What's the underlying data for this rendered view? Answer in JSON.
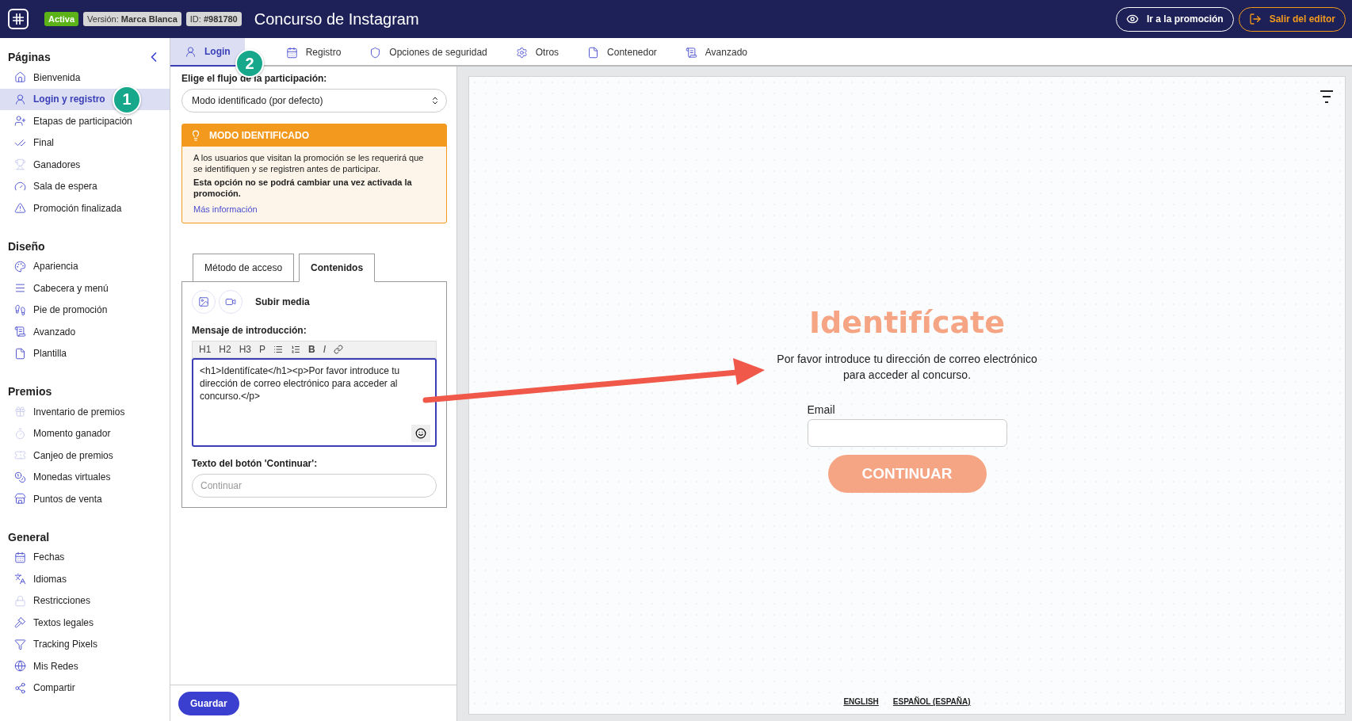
{
  "header": {
    "badges": [
      {
        "kind": "status",
        "value": "Activa"
      },
      {
        "kind": "tag",
        "label": "Versión:",
        "value": "Marca Blanca"
      },
      {
        "kind": "tag",
        "label": "ID:",
        "value": "#981780"
      }
    ],
    "title": "Concurso de Instagram",
    "actions": [
      {
        "kind": "outline",
        "label": "Ir a la promoción"
      },
      {
        "kind": "warning",
        "label": "Salir del editor"
      }
    ]
  },
  "sidebar": {
    "sections": [
      {
        "title": "Páginas",
        "items": [
          {
            "label": "Bienvenida",
            "selected": false,
            "disabled": false
          },
          {
            "label": "Login y registro",
            "selected": true,
            "disabled": false,
            "marker": "1"
          },
          {
            "label": "Etapas de participación",
            "selected": false,
            "disabled": false
          },
          {
            "label": "Final",
            "selected": false,
            "disabled": false
          },
          {
            "label": "Ganadores",
            "selected": false,
            "disabled": true
          },
          {
            "label": "Sala de espera",
            "selected": false,
            "disabled": false
          },
          {
            "label": "Promoción finalizada",
            "selected": false,
            "disabled": false
          }
        ]
      },
      {
        "title": "Diseño",
        "items": [
          {
            "label": "Apariencia",
            "selected": false,
            "disabled": false
          },
          {
            "label": "Cabecera y menú",
            "selected": false,
            "disabled": false
          },
          {
            "label": "Pie de promoción",
            "selected": false,
            "disabled": false
          },
          {
            "label": "Avanzado",
            "selected": false,
            "disabled": false
          },
          {
            "label": "Plantilla",
            "selected": false,
            "disabled": false
          }
        ]
      },
      {
        "title": "Premios",
        "items": [
          {
            "label": "Inventario de premios",
            "selected": false,
            "disabled": true
          },
          {
            "label": "Momento ganador",
            "selected": false,
            "disabled": true
          },
          {
            "label": "Canjeo de premios",
            "selected": false,
            "disabled": true
          },
          {
            "label": "Monedas virtuales",
            "selected": false,
            "disabled": false
          },
          {
            "label": "Puntos de venta",
            "selected": false,
            "disabled": false
          }
        ]
      },
      {
        "title": "General",
        "items": [
          {
            "label": "Fechas",
            "selected": false,
            "disabled": false
          },
          {
            "label": "Idiomas",
            "selected": false,
            "disabled": false
          },
          {
            "label": "Restricciones",
            "selected": false,
            "disabled": true
          },
          {
            "label": "Textos legales",
            "selected": false,
            "disabled": false
          },
          {
            "label": "Tracking Pixels",
            "selected": false,
            "disabled": false
          },
          {
            "label": "Mis Redes",
            "selected": false,
            "disabled": false
          },
          {
            "label": "Compartir",
            "selected": false,
            "disabled": false
          }
        ]
      }
    ]
  },
  "tabs": [
    {
      "label": "Login",
      "selected": true,
      "marker": "2"
    },
    {
      "label": "Registro",
      "selected": false
    },
    {
      "label": "Opciones de seguridad",
      "selected": false
    },
    {
      "label": "Otros",
      "selected": false
    },
    {
      "label": "Contenedor",
      "selected": false
    },
    {
      "label": "Avanzado",
      "selected": false
    }
  ],
  "panel": {
    "flow_label": "Elige el flujo de la participación:",
    "flow_select": "Modo identificado (por defecto)",
    "alert": {
      "title": "MODO IDENTIFICADO",
      "text": "A los usuarios que visitan la promoción se les requerirá que se identifiquen y se registren antes de participar.",
      "note": "Esta opción no se podrá cambiar una vez activada la promoción.",
      "link": "Más información"
    },
    "subtabs": [
      {
        "label": "Método de acceso",
        "selected": false
      },
      {
        "label": "Contenidos",
        "selected": true
      }
    ],
    "upload_label": "Subir media",
    "intro_label": "Mensaje de introducción:",
    "toolbar": [
      {
        "kind": "text",
        "label": "H1"
      },
      {
        "kind": "text",
        "label": "H2"
      },
      {
        "kind": "text",
        "label": "H3"
      },
      {
        "kind": "text",
        "label": "P"
      },
      {
        "kind": "bullets"
      },
      {
        "kind": "numbers"
      },
      {
        "kind": "bold",
        "label": "B"
      },
      {
        "kind": "italic",
        "label": "I"
      },
      {
        "kind": "link"
      }
    ],
    "intro_value": "<h1>Identifícate</h1><p>Por favor introduce tu dirección de correo electrónico para acceder al concurso.</p>",
    "button_text_label": "Texto del botón 'Continuar':",
    "button_text_placeholder": "Continuar",
    "save": "Guardar"
  },
  "preview": {
    "heading": "Identifícate",
    "text": "Por favor introduce tu dirección de correo electrónico para acceder al concurso.",
    "email_label": "Email",
    "button": "CONTINUAR",
    "languages": [
      "ENGLISH",
      "ESPAÑOL (ESPAÑA)"
    ]
  }
}
